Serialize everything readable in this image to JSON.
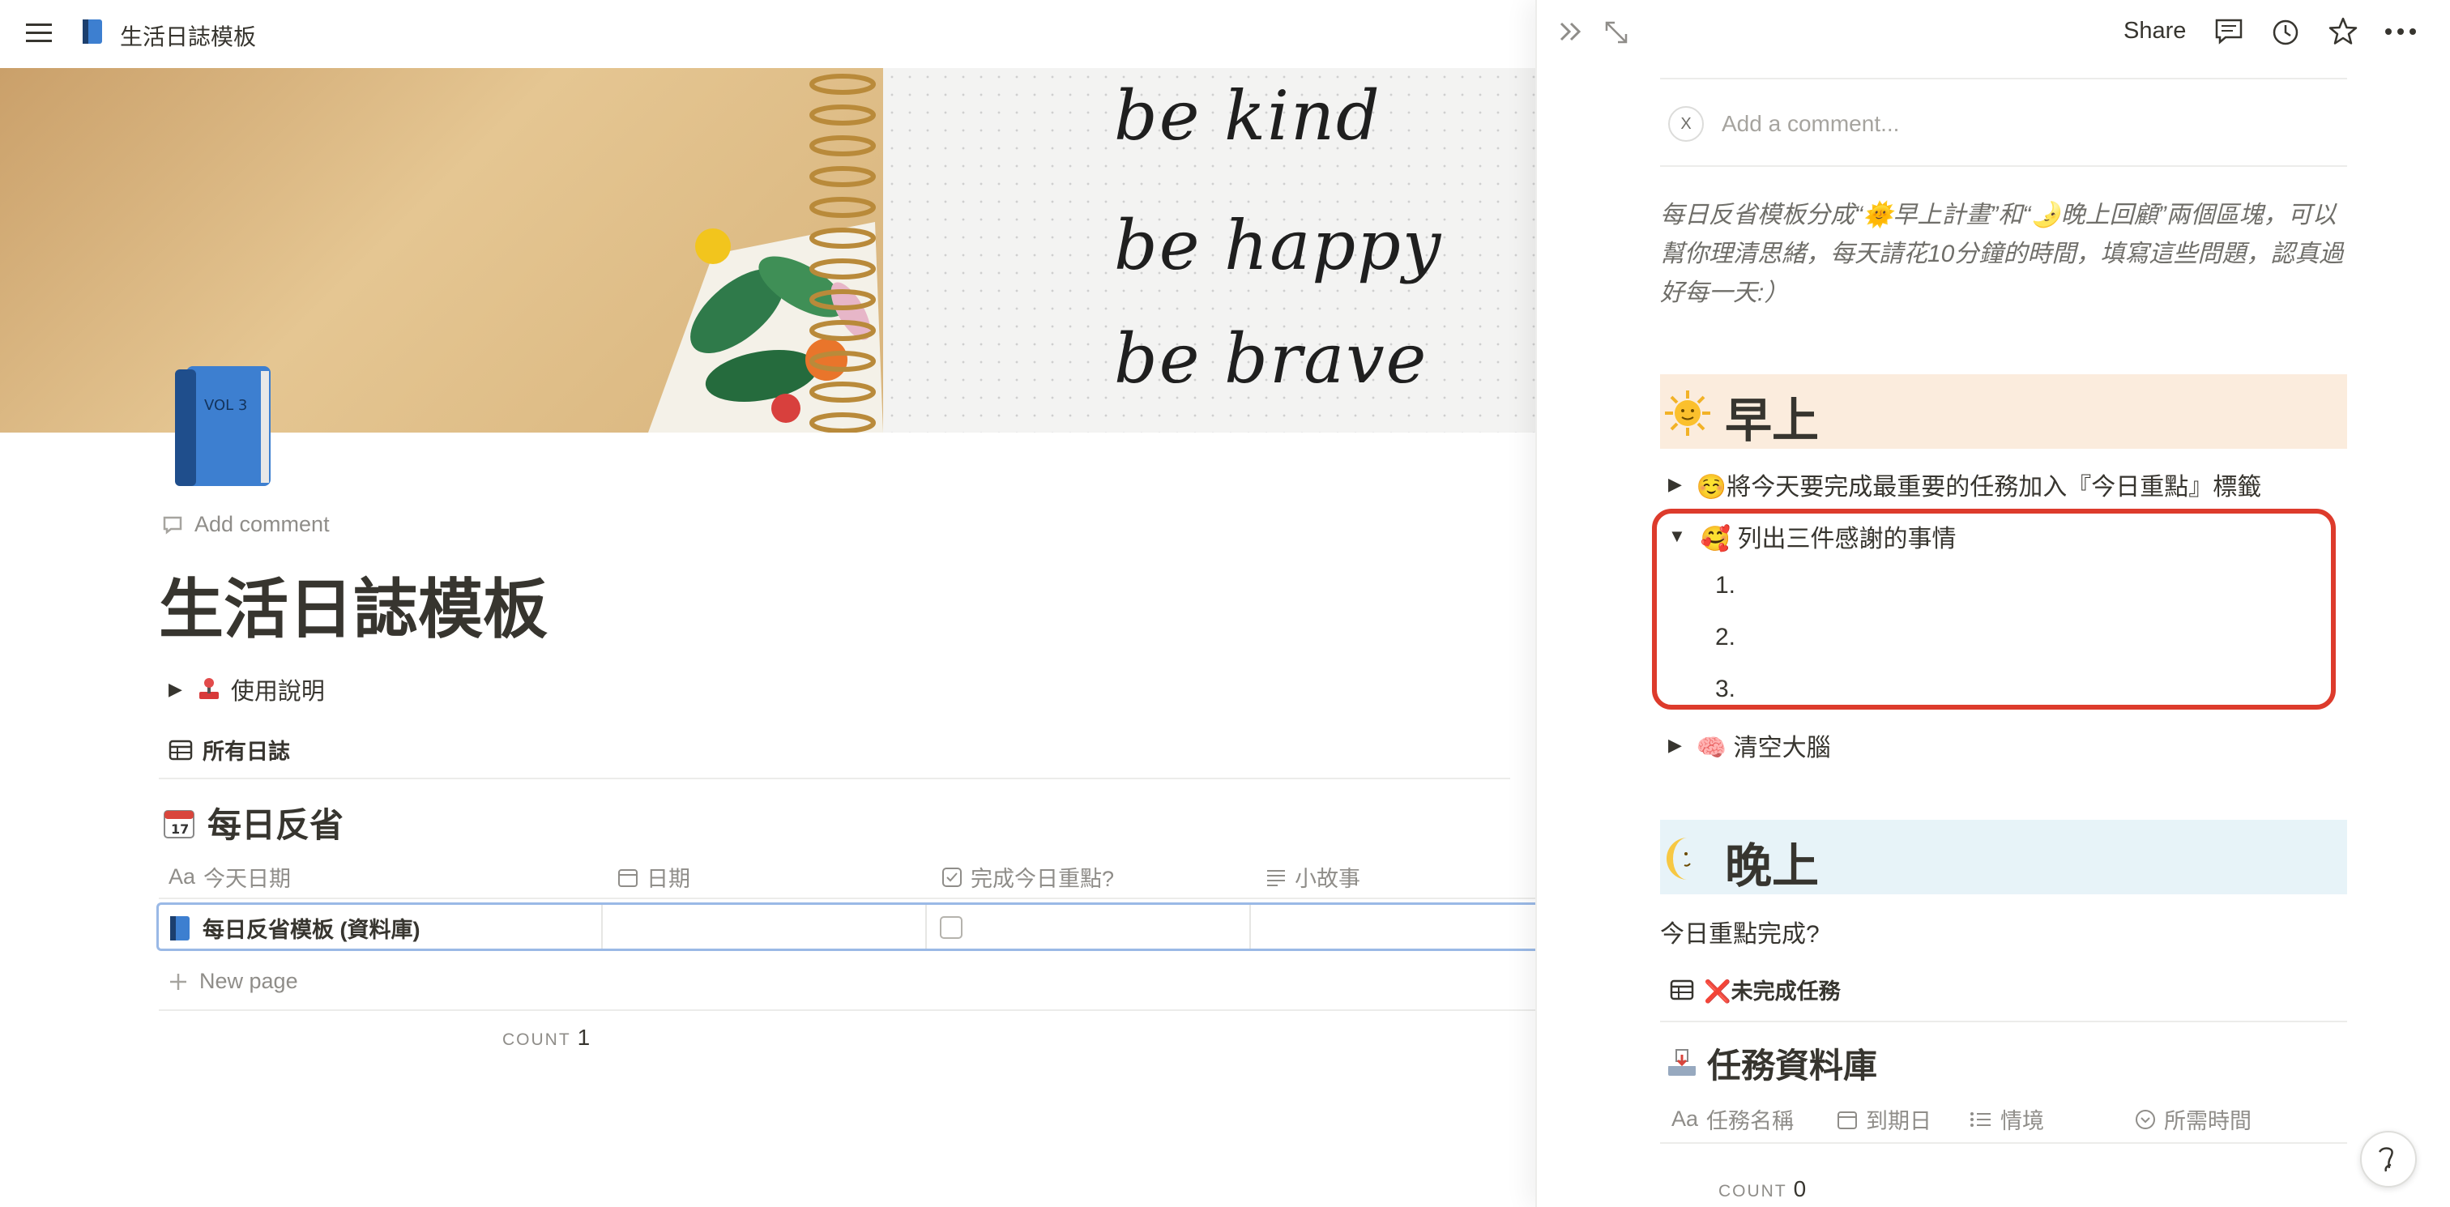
{
  "window": {
    "breadcrumb_title": "生活日誌模板"
  },
  "cover": {
    "line1": "be kind",
    "line2": "be happy",
    "line3": "be brave"
  },
  "page": {
    "add_comment": "Add comment",
    "title": "生活日誌模板",
    "usage_toggle": "使用說明",
    "all_journals_link": "所有日誌",
    "db_title": "每日反省",
    "columns": [
      {
        "label": "今天日期",
        "prefix": "Aa"
      },
      {
        "label": "日期"
      },
      {
        "label": "完成今日重點?"
      },
      {
        "label": "小故事"
      }
    ],
    "row": {
      "title": "每日反省模板 (資料庫)"
    },
    "new_page": "New page",
    "count_label": "COUNT",
    "count_value": "1"
  },
  "peek": {
    "share": "Share",
    "comment_placeholder": "Add a comment...",
    "comment_avatar": "X",
    "description": "每日反省模板分成“🌞早上計畫”和“🌛晚上回顧”兩個區塊，可以幫你理清思緒，每天請花10分鐘的時間，填寫這些問題，認真過好每一天:）",
    "morning_heading": "早上",
    "morning_items": [
      "☺️將今天要完成最重要的任務加入『今日重點』標籤",
      "🥰 列出三件感謝的事情",
      "🧠 清空大腦"
    ],
    "numbered": [
      "1.",
      "2.",
      "3."
    ],
    "evening_heading": "晚上",
    "evening_question": "今日重點完成?",
    "task_link": "❌未完成任務",
    "task_db_title": "任務資料庫",
    "task_columns": [
      {
        "label": "任務名稱",
        "prefix": "Aa"
      },
      {
        "label": "到期日"
      },
      {
        "label": "情境"
      },
      {
        "label": "所需時間"
      }
    ],
    "count_label": "COUNT",
    "count_value": "0"
  },
  "colors": {
    "text": "#37352f",
    "muted": "#8f8d89",
    "morning_band": "#fbecdd",
    "evening_band": "#e7f3f8",
    "highlight_red": "#dd3b2c",
    "row_selected_border": "#9ab9e6"
  }
}
